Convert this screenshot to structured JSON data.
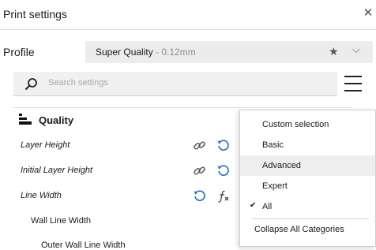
{
  "window": {
    "title": "Print settings",
    "close_glyph": "✕"
  },
  "profile": {
    "label": "Profile",
    "name": "Super Quality",
    "detail": " - 0.12mm",
    "star_glyph": "★",
    "chevron_glyph": "⌵"
  },
  "search": {
    "placeholder": "Search settings",
    "value": ""
  },
  "category": {
    "title": "Quality"
  },
  "settings": [
    {
      "label": "Layer Height"
    },
    {
      "label": "Initial Layer Height"
    },
    {
      "label": "Line Width"
    },
    {
      "label": "Wall Line Width"
    },
    {
      "label": "Outer Wall Line Width"
    }
  ],
  "visibility_menu": {
    "items": [
      {
        "label": "Custom selection"
      },
      {
        "label": "Basic"
      },
      {
        "label": "Advanced"
      },
      {
        "label": "Expert"
      },
      {
        "label": "All",
        "check": "✔"
      }
    ],
    "collapse_label": "Collapse All Categories"
  },
  "colors": {
    "accent": "#2d6fd6",
    "highlight": "#eeeeee"
  }
}
